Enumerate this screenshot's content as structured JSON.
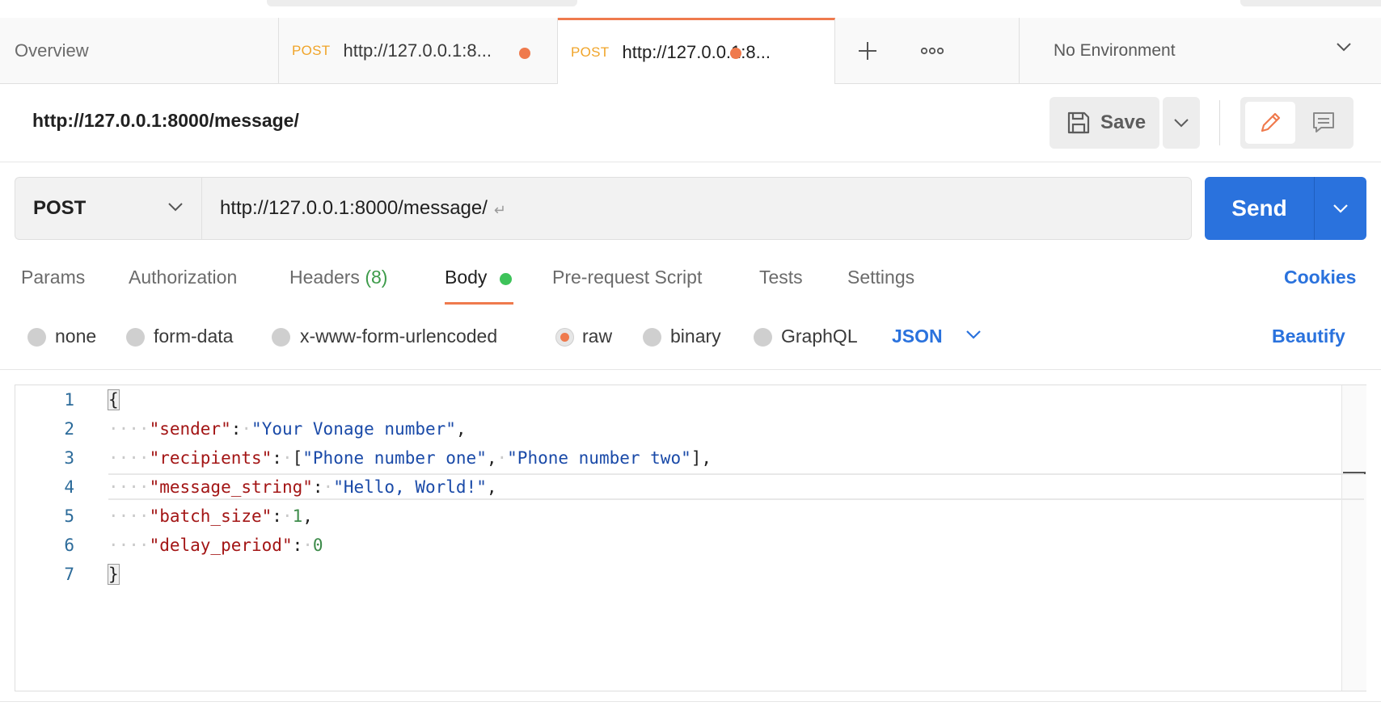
{
  "tabs": {
    "overview_label": "Overview",
    "req1": {
      "method": "POST",
      "title": "http://127.0.0.1:8..."
    },
    "req2": {
      "method": "POST",
      "title": "http://127.0.0.1:8..."
    }
  },
  "environment": {
    "label": "No Environment"
  },
  "request": {
    "title": "http://127.0.0.1:8000/message/",
    "method": "POST",
    "url": "http://127.0.0.1:8000/message/",
    "url_return_glyph": "↵"
  },
  "toolbar": {
    "save_label": "Save",
    "send_label": "Send"
  },
  "request_tabs": {
    "params": "Params",
    "authorization": "Authorization",
    "headers": "Headers",
    "headers_count": "(8)",
    "body": "Body",
    "prerequest": "Pre-request Script",
    "tests": "Tests",
    "settings": "Settings",
    "cookies": "Cookies"
  },
  "body_types": {
    "none": "none",
    "form_data": "form-data",
    "urlencoded": "x-www-form-urlencoded",
    "raw": "raw",
    "binary": "binary",
    "graphql": "GraphQL",
    "selected": "raw",
    "language": "JSON",
    "beautify": "Beautify"
  },
  "editor": {
    "line_numbers": [
      "1",
      "2",
      "3",
      "4",
      "5",
      "6",
      "7"
    ],
    "open_brace": "{",
    "close_brace": "}",
    "sender_key": "\"sender\"",
    "sender_value": "\"Your Vonage number\"",
    "recipients_key": "\"recipients\"",
    "recipient_1": "\"Phone number one\"",
    "recipient_2": "\"Phone number two\"",
    "message_key": "\"message_string\"",
    "message_value": "\"Hello, World!\"",
    "batch_key": "\"batch_size\"",
    "batch_value": "1",
    "delay_key": "\"delay_period\"",
    "delay_value": "0"
  },
  "colors": {
    "accent": "#ef7a4d",
    "send_blue": "#2a72dd",
    "method_post": "#f0a429",
    "body_dot": "#3ec35a"
  }
}
